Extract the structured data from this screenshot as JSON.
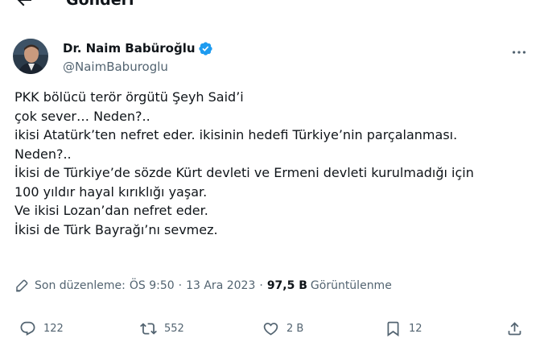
{
  "header": {
    "title": "Gönderi",
    "back_icon": "arrow-left-icon"
  },
  "author": {
    "display_name": "Dr. Naim Babüroğlu",
    "handle": "@NaimBaburoglu",
    "verified": true,
    "verified_color": "#1d9bf0"
  },
  "tweet": {
    "lines": [
      "PKK bölücü terör örgütü Şeyh Said’i",
      "çok sever… Neden?..",
      "ikisi Atatürk’ten nefret eder. ikisinin hedefi Türkiye’nin parçalanması.",
      "Neden?..",
      "İkisi de Türkiye’de sözde Kürt devleti ve Ermeni devleti kurulmadığı için",
      "100 yıldır hayal kırıklığı yaşar.",
      "Ve ikisi Lozan’dan nefret eder.",
      "İkisi de Türk Bayrağı’nı sevmez."
    ]
  },
  "meta": {
    "edited_label": "Son düzenleme:",
    "time": "ÖS 9:50",
    "date": "13 Ara 2023",
    "separator": "·",
    "views_count": "97,5 B",
    "views_label": "Görüntülenme"
  },
  "actions": {
    "reply_count": "122",
    "retweet_count": "552",
    "like_count": "2 B",
    "bookmark_count": "12"
  },
  "colors": {
    "text": "#0f1419",
    "secondary": "#536471",
    "accent": "#1d9bf0"
  }
}
